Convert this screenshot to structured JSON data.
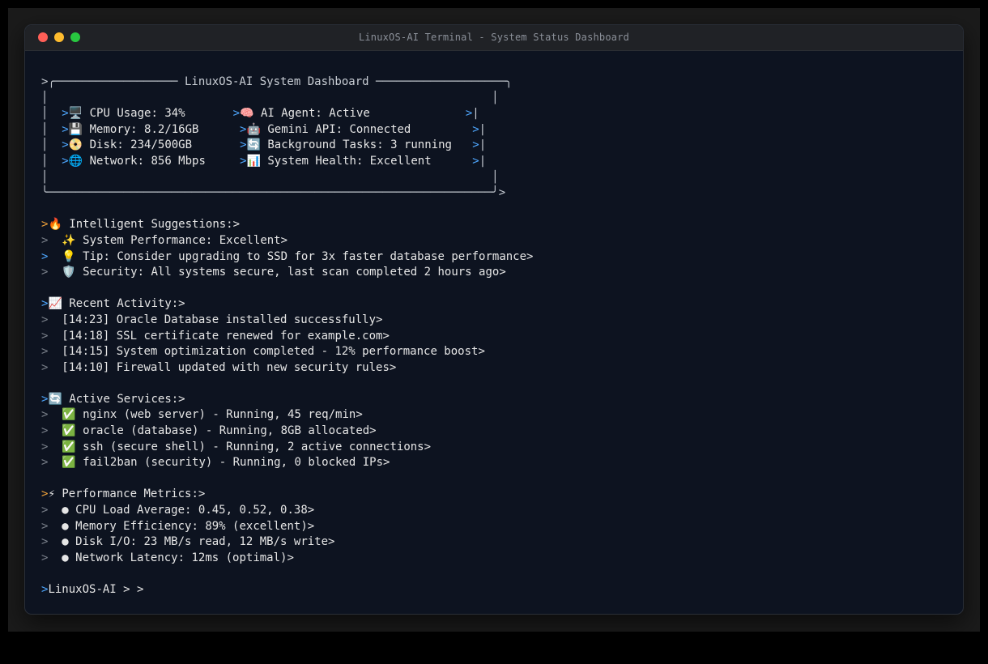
{
  "window": {
    "title": "LinuxOS-AI Terminal - System Status Dashboard"
  },
  "colors": {
    "background": "#0d1320",
    "prompt_accent": "#4fa8ff",
    "prompt_muted": "#7a808a",
    "prompt_warm": "#f0a23a",
    "text": "#e6e6e6"
  },
  "dashboard": {
    "top_border": ">╭────────────────── LinuxOS-AI System Dashboard ───────────────────╮",
    "blank_a": "│                                                                 │",
    "rows": [
      {
        "left_icon": "🖥️",
        "left_text": " CPU Usage: 34%",
        "right_icon": "🧠",
        "right_text": "AI Agent: Active"
      },
      {
        "left_icon": "💾",
        "left_text": "Memory: 8.2/16GB",
        "right_icon": "🤖",
        "right_text": "Gemini API: Connected"
      },
      {
        "left_icon": "📀",
        "left_text": "Disk: 234/500GB",
        "right_icon": "🔄",
        "right_text": "Background Tasks: 3 running"
      },
      {
        "left_icon": "🌐",
        "left_text": "Network: 856 Mbps",
        "right_icon": "📊",
        "right_text": "System Health: Excellent"
      }
    ],
    "blank_b": "│                                                                 │",
    "bottom_border": "╰─────────────────────────────────────────────────────────────────╯>"
  },
  "sections": [
    {
      "header_icon": "🔥",
      "header": "Intelligent Suggestions:>",
      "items": [
        {
          "icon": "✨",
          "text": "System Performance: Excellent>"
        },
        {
          "icon": "💡",
          "text": "Tip: Consider upgrading to SSD for 3x faster database performance>"
        },
        {
          "icon": "🛡️",
          "text": "Security: All systems secure, last scan completed 2 hours ago>"
        }
      ]
    },
    {
      "header_icon": "📈",
      "header": "Recent Activity:>",
      "items": [
        {
          "icon": "",
          "text": "[14:23] Oracle Database installed successfully>"
        },
        {
          "icon": "",
          "text": "[14:18] SSL certificate renewed for example.com>"
        },
        {
          "icon": "",
          "text": "[14:15] System optimization completed - 12% performance boost>"
        },
        {
          "icon": "",
          "text": "[14:10] Firewall updated with new security rules>"
        }
      ]
    },
    {
      "header_icon": "🔄",
      "header": "Active Services:>",
      "items": [
        {
          "icon": "✅",
          "text": "nginx (web server) - Running, 45 req/min>"
        },
        {
          "icon": "✅",
          "text": "oracle (database) - Running, 8GB allocated>"
        },
        {
          "icon": "✅",
          "text": "ssh (secure shell) - Running, 2 active connections>"
        },
        {
          "icon": "✅",
          "text": "fail2ban (security) - Running, 0 blocked IPs>"
        }
      ]
    },
    {
      "header_icon": "⚡",
      "header": "Performance Metrics:>",
      "items": [
        {
          "icon": "●",
          "text": "CPU Load Average: 0.45, 0.52, 0.38>"
        },
        {
          "icon": "●",
          "text": "Memory Efficiency: 89% (excellent)>"
        },
        {
          "icon": "●",
          "text": "Disk I/O: 23 MB/s read, 12 MB/s write>"
        },
        {
          "icon": "●",
          "text": "Network Latency: 12ms (optimal)>"
        }
      ]
    }
  ],
  "prompt": {
    "text": "LinuxOS-AI > >"
  }
}
